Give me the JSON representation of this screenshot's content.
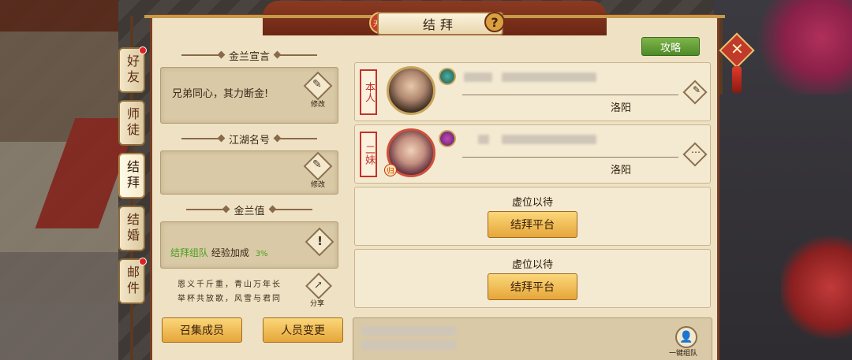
{
  "window": {
    "title": "结拜",
    "seal_text": "天涯",
    "help_symbol": "?",
    "guide_label": "攻略",
    "close_symbol": "✕"
  },
  "tabs": [
    {
      "label": "好友",
      "active": false,
      "notify": true
    },
    {
      "label": "师徒",
      "active": false,
      "notify": false
    },
    {
      "label": "结拜",
      "active": true,
      "notify": false
    },
    {
      "label": "结婚",
      "active": false,
      "notify": false
    },
    {
      "label": "邮件",
      "active": false,
      "notify": true
    }
  ],
  "left": {
    "declaration_title": "金兰宣言",
    "declaration_text": "兄弟同心，其力断金!",
    "edit_label": "修改",
    "nickname_title": "江湖名号",
    "nickname_text": "",
    "value_title": "金兰值",
    "bonus_highlight": "结拜组队",
    "bonus_text": "经验加成",
    "bonus_value": "3%",
    "poem_line1": "恩义千斤重，青山万年长",
    "poem_line2": "举杯共放歌，风雪与君同",
    "share_label": "分享",
    "gather_button": "召集成员",
    "change_button": "人员变更"
  },
  "members": [
    {
      "rank": "本人",
      "location": "洛阳",
      "gender_badge": "",
      "class_color": "#2f8a7a"
    },
    {
      "rank": "二妹",
      "location": "洛阳",
      "gender_badge": "归",
      "class_color": "#9a2f9a"
    }
  ],
  "empty_slots": [
    {
      "label": "虚位以待",
      "button": "结拜平台"
    },
    {
      "label": "虚位以待",
      "button": "结拜平台"
    }
  ],
  "team": {
    "button_label": "一键组队"
  },
  "icons": {
    "edit": "brush-icon",
    "warn": "exclamation-icon",
    "share": "share-icon",
    "more": "more-icon",
    "team": "team-icon",
    "close": "close-icon",
    "help": "help-icon"
  }
}
